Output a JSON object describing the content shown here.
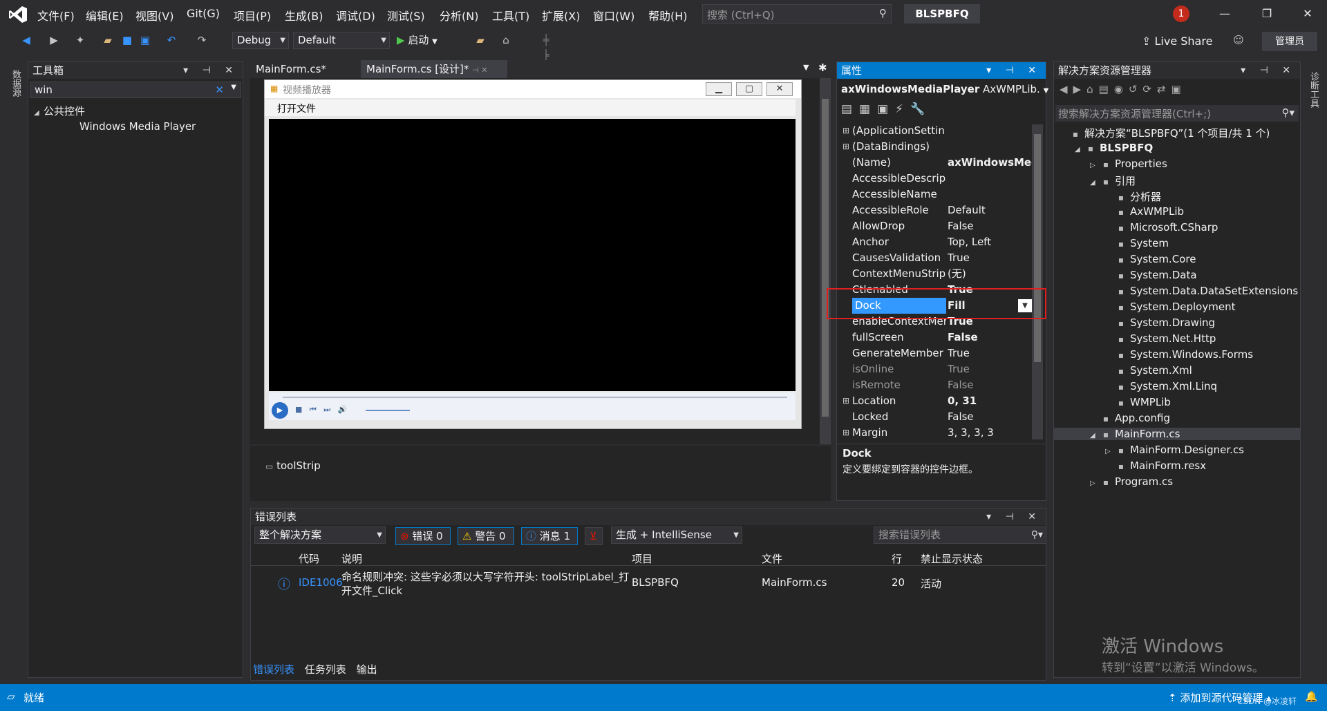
{
  "menubar": {
    "items": [
      "文件(F)",
      "编辑(E)",
      "视图(V)",
      "Git(G)",
      "项目(P)",
      "生成(B)",
      "调试(D)",
      "测试(S)",
      "分析(N)",
      "工具(T)",
      "扩展(X)",
      "窗口(W)",
      "帮助(H)"
    ],
    "search_placeholder": "搜索 (Ctrl+Q)",
    "project_name": "BLSPBFQ",
    "notification_count": "1"
  },
  "toolbar": {
    "config": "Debug",
    "platform": "Default",
    "start": "启动",
    "live_share": "Live Share",
    "admin": "管理员"
  },
  "left_side_tab": "数据源",
  "right_side_tab": "诊断工具",
  "toolbox": {
    "title": "工具箱",
    "search_value": "win",
    "group": "公共控件",
    "item": "Windows Media Player"
  },
  "doc_tabs": [
    "MainForm.cs*",
    "MainForm.cs [设计]*"
  ],
  "form": {
    "title": "视频播放器",
    "menu_item": "打开文件",
    "toolstrip_label": "toolStrip"
  },
  "properties": {
    "title": "属性",
    "object_name": "axWindowsMediaPlayer",
    "object_type": "AxWMPLib.",
    "rows": [
      {
        "k": "(ApplicationSettin",
        "v": "",
        "exp": true
      },
      {
        "k": "(DataBindings)",
        "v": "",
        "exp": true
      },
      {
        "k": "(Name)",
        "v": "axWindowsMed",
        "bold": true
      },
      {
        "k": "AccessibleDescrip",
        "v": ""
      },
      {
        "k": "AccessibleName",
        "v": ""
      },
      {
        "k": "AccessibleRole",
        "v": "Default"
      },
      {
        "k": "AllowDrop",
        "v": "False"
      },
      {
        "k": "Anchor",
        "v": "Top, Left"
      },
      {
        "k": "CausesValidation",
        "v": "True"
      },
      {
        "k": "ContextMenuStrip",
        "v": "(无)"
      },
      {
        "k": "Ctlenabled",
        "v": "True",
        "bold": true
      },
      {
        "k": "Dock",
        "v": "Fill",
        "bold": true,
        "selected": true
      },
      {
        "k": "enableContextMer",
        "v": "True",
        "bold": true
      },
      {
        "k": "fullScreen",
        "v": "False",
        "bold": true
      },
      {
        "k": "GenerateMember",
        "v": "True"
      },
      {
        "k": "isOnline",
        "v": "True",
        "dim": true
      },
      {
        "k": "isRemote",
        "v": "False",
        "dim": true
      },
      {
        "k": "Location",
        "v": "0, 31",
        "bold": true,
        "exp": true
      },
      {
        "k": "Locked",
        "v": "False"
      },
      {
        "k": "Margin",
        "v": "3, 3, 3, 3",
        "exp": true
      }
    ],
    "desc_title": "Dock",
    "desc_text": "定义要绑定到容器的控件边框。"
  },
  "solution": {
    "title": "解决方案资源管理器",
    "search_placeholder": "搜索解决方案资源管理器(Ctrl+;)",
    "nodes": [
      {
        "t": "解决方案“BLSPBFQ”(1 个项目/共 1 个)",
        "lvl": 0,
        "tri": ""
      },
      {
        "t": "BLSPBFQ",
        "lvl": 1,
        "tri": "◢",
        "bold": true
      },
      {
        "t": "Properties",
        "lvl": 2,
        "tri": "▷"
      },
      {
        "t": "引用",
        "lvl": 2,
        "tri": "◢"
      },
      {
        "t": "分析器",
        "lvl": 3,
        "tri": ""
      },
      {
        "t": "AxWMPLib",
        "lvl": 3,
        "tri": ""
      },
      {
        "t": "Microsoft.CSharp",
        "lvl": 3,
        "tri": ""
      },
      {
        "t": "System",
        "lvl": 3,
        "tri": ""
      },
      {
        "t": "System.Core",
        "lvl": 3,
        "tri": ""
      },
      {
        "t": "System.Data",
        "lvl": 3,
        "tri": ""
      },
      {
        "t": "System.Data.DataSetExtensions",
        "lvl": 3,
        "tri": ""
      },
      {
        "t": "System.Deployment",
        "lvl": 3,
        "tri": ""
      },
      {
        "t": "System.Drawing",
        "lvl": 3,
        "tri": ""
      },
      {
        "t": "System.Net.Http",
        "lvl": 3,
        "tri": ""
      },
      {
        "t": "System.Windows.Forms",
        "lvl": 3,
        "tri": ""
      },
      {
        "t": "System.Xml",
        "lvl": 3,
        "tri": ""
      },
      {
        "t": "System.Xml.Linq",
        "lvl": 3,
        "tri": ""
      },
      {
        "t": "WMPLib",
        "lvl": 3,
        "tri": ""
      },
      {
        "t": "App.config",
        "lvl": 2,
        "tri": ""
      },
      {
        "t": "MainForm.cs",
        "lvl": 2,
        "tri": "◢",
        "sel": true
      },
      {
        "t": "MainForm.Designer.cs",
        "lvl": 3,
        "tri": "▷"
      },
      {
        "t": "MainForm.resx",
        "lvl": 3,
        "tri": ""
      },
      {
        "t": "Program.cs",
        "lvl": 2,
        "tri": "▷"
      }
    ]
  },
  "errors": {
    "title": "错误列表",
    "scope": "整个解决方案",
    "errors_btn": "错误 0",
    "warnings_btn": "警告 0",
    "messages_btn": "消息 1",
    "build_filter": "生成 + IntelliSense",
    "search_placeholder": "搜索错误列表",
    "columns": [
      "代码",
      "说明",
      "项目",
      "文件",
      "行",
      "禁止显示状态"
    ],
    "row": {
      "code": "IDE1006",
      "desc1": "命名规则冲突: 这些字必须以大写字符开头: toolStripLabel_打",
      "desc2": "开文件_Click",
      "project": "BLSPBFQ",
      "file": "MainForm.cs",
      "line": "20",
      "state": "活动"
    },
    "bottom_tabs": [
      "错误列表",
      "任务列表",
      "输出"
    ]
  },
  "watermark": {
    "line1": "激活 Windows",
    "line2": "转到“设置”以激活 Windows。"
  },
  "status": {
    "ready": "就绪",
    "source_control": "添加到源代码管理",
    "csdn": "CSDN @冰凌轩"
  }
}
